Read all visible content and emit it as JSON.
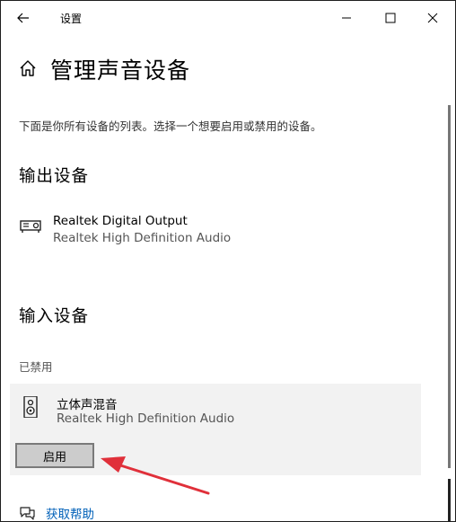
{
  "window": {
    "title": "设置"
  },
  "page": {
    "title": "管理声音设备",
    "description": "下面是你所有设备的列表。选择一个想要启用或禁用的设备。"
  },
  "output_section": {
    "heading": "输出设备",
    "devices": [
      {
        "name": "Realtek Digital Output",
        "sub": "Realtek High Definition Audio",
        "icon": "speaker-box-icon"
      }
    ]
  },
  "input_section": {
    "heading": "输入设备",
    "disabled_label": "已禁用",
    "devices": [
      {
        "name": "立体声混音",
        "sub": "Realtek High Definition Audio",
        "icon": "speaker-icon"
      }
    ],
    "enable_button": "启用"
  },
  "help": {
    "label": "获取帮助",
    "icon": "help-chat-icon"
  },
  "colors": {
    "accent": "#0060b8",
    "annotation_arrow": "#e0303a",
    "panel_bg": "#f2f2f2",
    "button_bg": "#cccccc"
  }
}
